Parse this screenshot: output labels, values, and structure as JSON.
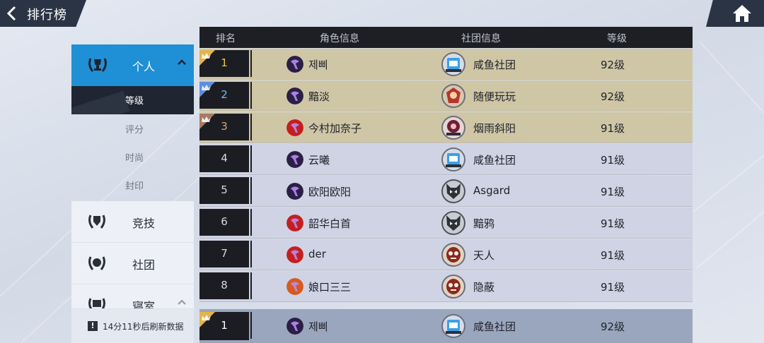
{
  "header": {
    "title": "排行榜"
  },
  "table": {
    "columns": [
      "排名",
      "角色信息",
      "社团信息",
      "等级"
    ],
    "rows": [
      {
        "rank": "1",
        "name": "제삐",
        "club": "咸鱼社团",
        "level": "92级",
        "crown": "gold",
        "rank_color": "#f1c63c",
        "class": "purple",
        "badge": "blue"
      },
      {
        "rank": "2",
        "name": "黯淡",
        "club": "随便玩玩",
        "level": "92级",
        "crown": "blue",
        "rank_color": "#6fb8ff",
        "class": "purple",
        "badge": "red"
      },
      {
        "rank": "3",
        "name": "今村加奈子",
        "club": "烟雨斜阳",
        "level": "91级",
        "crown": "bronze",
        "rank_color": "#d7a27c",
        "class": "red",
        "badge": "pink"
      },
      {
        "rank": "4",
        "name": "云曦",
        "club": "咸鱼社团",
        "level": "91级",
        "crown": "",
        "rank_color": "#d6d9df",
        "class": "purple",
        "badge": "blue"
      },
      {
        "rank": "5",
        "name": "欧阳欧阳",
        "club": "Asgard",
        "level": "91级",
        "crown": "",
        "rank_color": "#d6d9df",
        "class": "purple",
        "badge": "wolf"
      },
      {
        "rank": "6",
        "name": "韶华白首",
        "club": "黯鸦",
        "level": "91级",
        "crown": "",
        "rank_color": "#d6d9df",
        "class": "red",
        "badge": "wolf"
      },
      {
        "rank": "7",
        "name": "der",
        "club": "天人",
        "level": "91级",
        "crown": "",
        "rank_color": "#d6d9df",
        "class": "red",
        "badge": "mask"
      },
      {
        "rank": "8",
        "name": "娘口三三",
        "club": "隐蔽",
        "level": "91级",
        "crown": "",
        "rank_color": "#d6d9df",
        "class": "orange",
        "badge": "mask"
      }
    ]
  },
  "self_row": {
    "rank": "1",
    "name": "제삐",
    "club": "咸鱼社团",
    "level": "92级",
    "crown": "gold",
    "class": "purple",
    "badge": "blue"
  },
  "nav": {
    "personal": {
      "label": "个人"
    },
    "subs": [
      "等级",
      "评分",
      "时尚",
      "封印"
    ],
    "categories": [
      {
        "label": "竞技"
      },
      {
        "label": "社团"
      },
      {
        "label": "寝室"
      }
    ]
  },
  "refresh_text": "14分11秒后刷新数据",
  "colors": {
    "accent": "#1f8fd6",
    "top3_row": "#cfc6a6",
    "other_row": "#d0d3e3",
    "self_row": "#9aa6be",
    "dark": "#1c1d22"
  }
}
